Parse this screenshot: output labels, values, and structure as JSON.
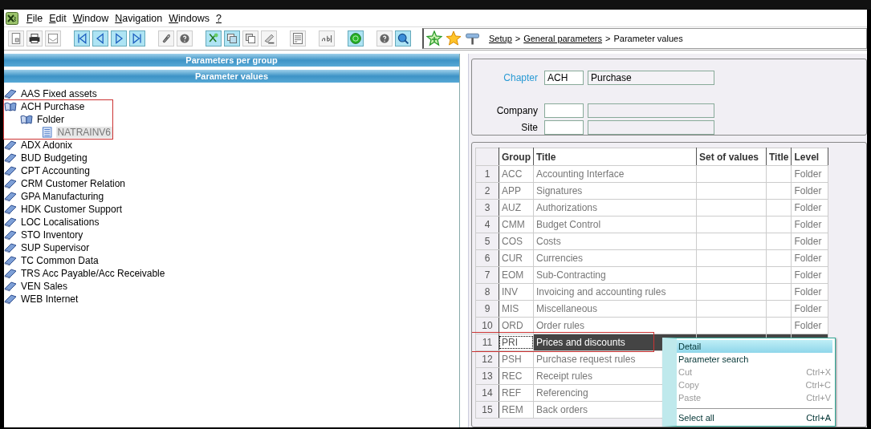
{
  "menu": [
    {
      "label": "File",
      "underline_first": true
    },
    {
      "label": "Edit",
      "underline_first": true
    },
    {
      "label": "Window",
      "underline_first": true
    },
    {
      "label": "Navigation",
      "underline_first": true
    },
    {
      "label": "Windows",
      "underline_first": true
    },
    {
      "label": "?",
      "underline_first": true
    }
  ],
  "toolbar": [
    {
      "kind": "page",
      "active": false
    },
    {
      "kind": "printer",
      "active": false
    },
    {
      "kind": "envelope",
      "active": false
    },
    {
      "kind": "first",
      "active": true
    },
    {
      "kind": "previous",
      "active": true
    },
    {
      "kind": "next",
      "active": true
    },
    {
      "kind": "last",
      "active": true
    },
    {
      "kind": "paperclip",
      "active": false
    },
    {
      "kind": "help",
      "active": false
    },
    {
      "kind": "scissors",
      "active": true
    },
    {
      "kind": "copy",
      "active": true
    },
    {
      "kind": "paste",
      "active": false
    },
    {
      "kind": "stamp",
      "active": false
    },
    {
      "kind": "form",
      "active": false
    },
    {
      "kind": "text",
      "active": false
    },
    {
      "kind": "globe",
      "active": true
    },
    {
      "kind": "help",
      "active": false
    },
    {
      "kind": "zoom",
      "active": true
    }
  ],
  "breadcrumb": [
    {
      "label": "Setup",
      "link": true
    },
    {
      "label": ">",
      "link": false
    },
    {
      "label": "General parameters",
      "link": true
    },
    {
      "label": ">",
      "link": false
    },
    {
      "label": "Parameter values",
      "link": false
    }
  ],
  "panel_headers": [
    "Parameters per group",
    "Parameter values"
  ],
  "tree": [
    {
      "label": "AAS Fixed assets",
      "kind": "book",
      "selected": false,
      "highlighted": false
    },
    {
      "label": "ACH Purchase",
      "kind": "open-book",
      "selected": false,
      "highlighted": true,
      "children": [
        {
          "label": "Folder",
          "kind": "open-book",
          "selected": false,
          "highlighted": false,
          "children": [
            {
              "label": "NATRAINV6",
              "kind": "document",
              "selected": true,
              "highlighted": false
            }
          ]
        }
      ]
    },
    {
      "label": "ADX Adonix",
      "kind": "book",
      "selected": false,
      "highlighted": false
    },
    {
      "label": "BUD Budgeting",
      "kind": "book",
      "selected": false,
      "highlighted": false
    },
    {
      "label": "CPT Accounting",
      "kind": "book",
      "selected": false,
      "highlighted": false
    },
    {
      "label": "CRM Customer Relation",
      "kind": "book",
      "selected": false,
      "highlighted": false
    },
    {
      "label": "GPA Manufacturing",
      "kind": "book",
      "selected": false,
      "highlighted": false
    },
    {
      "label": "HDK Customer Support",
      "kind": "book",
      "selected": false,
      "highlighted": false
    },
    {
      "label": "LOC Localisations",
      "kind": "book",
      "selected": false,
      "highlighted": false
    },
    {
      "label": "STO Inventory",
      "kind": "book",
      "selected": false,
      "highlighted": false
    },
    {
      "label": "SUP Supervisor",
      "kind": "book",
      "selected": false,
      "highlighted": false
    },
    {
      "label": "TC Common Data",
      "kind": "book",
      "selected": false,
      "highlighted": false
    },
    {
      "label": "TRS Acc Payable/Acc Receivable",
      "kind": "book",
      "selected": false,
      "highlighted": false
    },
    {
      "label": "VEN Sales",
      "kind": "book",
      "selected": false,
      "highlighted": false
    },
    {
      "label": "WEB Internet",
      "kind": "book",
      "selected": false,
      "highlighted": false
    }
  ],
  "form": {
    "fields": [
      {
        "label": "Chapter",
        "link": true,
        "code": "ACH",
        "description": "Purchase"
      },
      {
        "label": "Company",
        "link": false
      },
      {
        "label": "Site",
        "link": false
      }
    ]
  },
  "table": {
    "columns": [
      "Group",
      "Title",
      "Set of values",
      "Title",
      "Level"
    ],
    "rows": [
      {
        "num": "1",
        "group": "ACC",
        "title": "Accounting Interface",
        "level": "Folder",
        "selected": false,
        "highlighted": false
      },
      {
        "num": "2",
        "group": "APP",
        "title": "Signatures",
        "level": "Folder",
        "selected": false,
        "highlighted": false
      },
      {
        "num": "3",
        "group": "AUZ",
        "title": "Authorizations",
        "level": "Folder",
        "selected": false,
        "highlighted": false
      },
      {
        "num": "4",
        "group": "CMM",
        "title": "Budget Control",
        "level": "Folder",
        "selected": false,
        "highlighted": false
      },
      {
        "num": "5",
        "group": "COS",
        "title": "Costs",
        "level": "Folder",
        "selected": false,
        "highlighted": false
      },
      {
        "num": "6",
        "group": "CUR",
        "title": "Currencies",
        "level": "Folder",
        "selected": false,
        "highlighted": false
      },
      {
        "num": "7",
        "group": "EOM",
        "title": "Sub-Contracting",
        "level": "Folder",
        "selected": false,
        "highlighted": false
      },
      {
        "num": "8",
        "group": "INV",
        "title": "Invoicing and accounting rules",
        "level": "Folder",
        "selected": false,
        "highlighted": false
      },
      {
        "num": "9",
        "group": "MIS",
        "title": "Miscellaneous",
        "level": "Folder",
        "selected": false,
        "highlighted": false
      },
      {
        "num": "10",
        "group": "ORD",
        "title": "Order rules",
        "level": "Folder",
        "selected": false,
        "highlighted": false
      },
      {
        "num": "11",
        "group": "PRI",
        "title": "Prices and discounts",
        "selected": true,
        "highlighted": true
      },
      {
        "num": "12",
        "group": "PSH",
        "title": "Purchase request rules",
        "selected": false,
        "highlighted": false
      },
      {
        "num": "13",
        "group": "REC",
        "title": "Receipt rules",
        "selected": false,
        "highlighted": false
      },
      {
        "num": "14",
        "group": "REF",
        "title": "Referencing",
        "selected": false,
        "highlighted": false
      },
      {
        "num": "15",
        "group": "REM",
        "title": "Back orders",
        "selected": false,
        "highlighted": false
      }
    ]
  },
  "context_menu": [
    {
      "label": "Detail",
      "disabled": false,
      "selected": true,
      "separator_before": false
    },
    {
      "label": "Parameter search",
      "disabled": false,
      "selected": false,
      "separator_before": false
    },
    {
      "label": "Cut",
      "shortcut": "Ctrl+X",
      "disabled": true,
      "selected": false,
      "separator_before": false
    },
    {
      "label": "Copy",
      "shortcut": "Ctrl+C",
      "disabled": true,
      "selected": false,
      "separator_before": false
    },
    {
      "label": "Paste",
      "shortcut": "Ctrl+V",
      "disabled": true,
      "selected": false,
      "separator_before": false
    },
    {
      "label": "Select all",
      "shortcut": "Ctrl+A",
      "disabled": false,
      "selected": false,
      "separator_before": true
    }
  ]
}
